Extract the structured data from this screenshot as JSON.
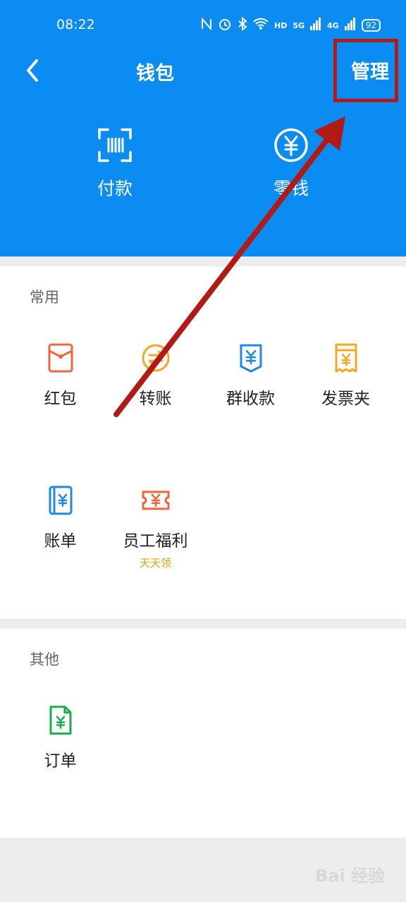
{
  "status_bar": {
    "time": "08:22",
    "icons": [
      "nfc-icon",
      "alarm-icon",
      "bluetooth-icon",
      "wifi-icon",
      "hd-icon",
      "signal-5g-icon",
      "signal-4g-icon"
    ],
    "hd_label": "HD",
    "signal1_label": "5G",
    "signal2_label": "4G",
    "battery": "92"
  },
  "nav": {
    "title": "钱包",
    "manage_label": "管理"
  },
  "quick_actions": [
    {
      "label": "付款",
      "icon": "scan-pay-icon"
    },
    {
      "label": "零钱",
      "icon": "yuan-circle-icon"
    }
  ],
  "sections": {
    "common": {
      "title": "常用",
      "items": [
        {
          "label": "红包",
          "icon": "red-packet-icon",
          "color": "#f0663a"
        },
        {
          "label": "转账",
          "icon": "transfer-icon",
          "color": "#f5a623"
        },
        {
          "label": "群收款",
          "icon": "group-collect-icon",
          "color": "#1e88e5"
        },
        {
          "label": "发票夹",
          "icon": "invoice-icon",
          "color": "#f5a623"
        },
        {
          "label": "账单",
          "icon": "bill-icon",
          "color": "#1e88e5"
        },
        {
          "label": "员工福利",
          "sub": "天天领",
          "icon": "ticket-icon",
          "color": "#f0663a"
        }
      ]
    },
    "other": {
      "title": "其他",
      "items": [
        {
          "label": "订单",
          "icon": "order-icon",
          "color": "#1aad49"
        }
      ]
    }
  },
  "watermark": "Bai 经验",
  "colors": {
    "header_bg": "#0b8cf2",
    "annotation": "#b21a16"
  }
}
